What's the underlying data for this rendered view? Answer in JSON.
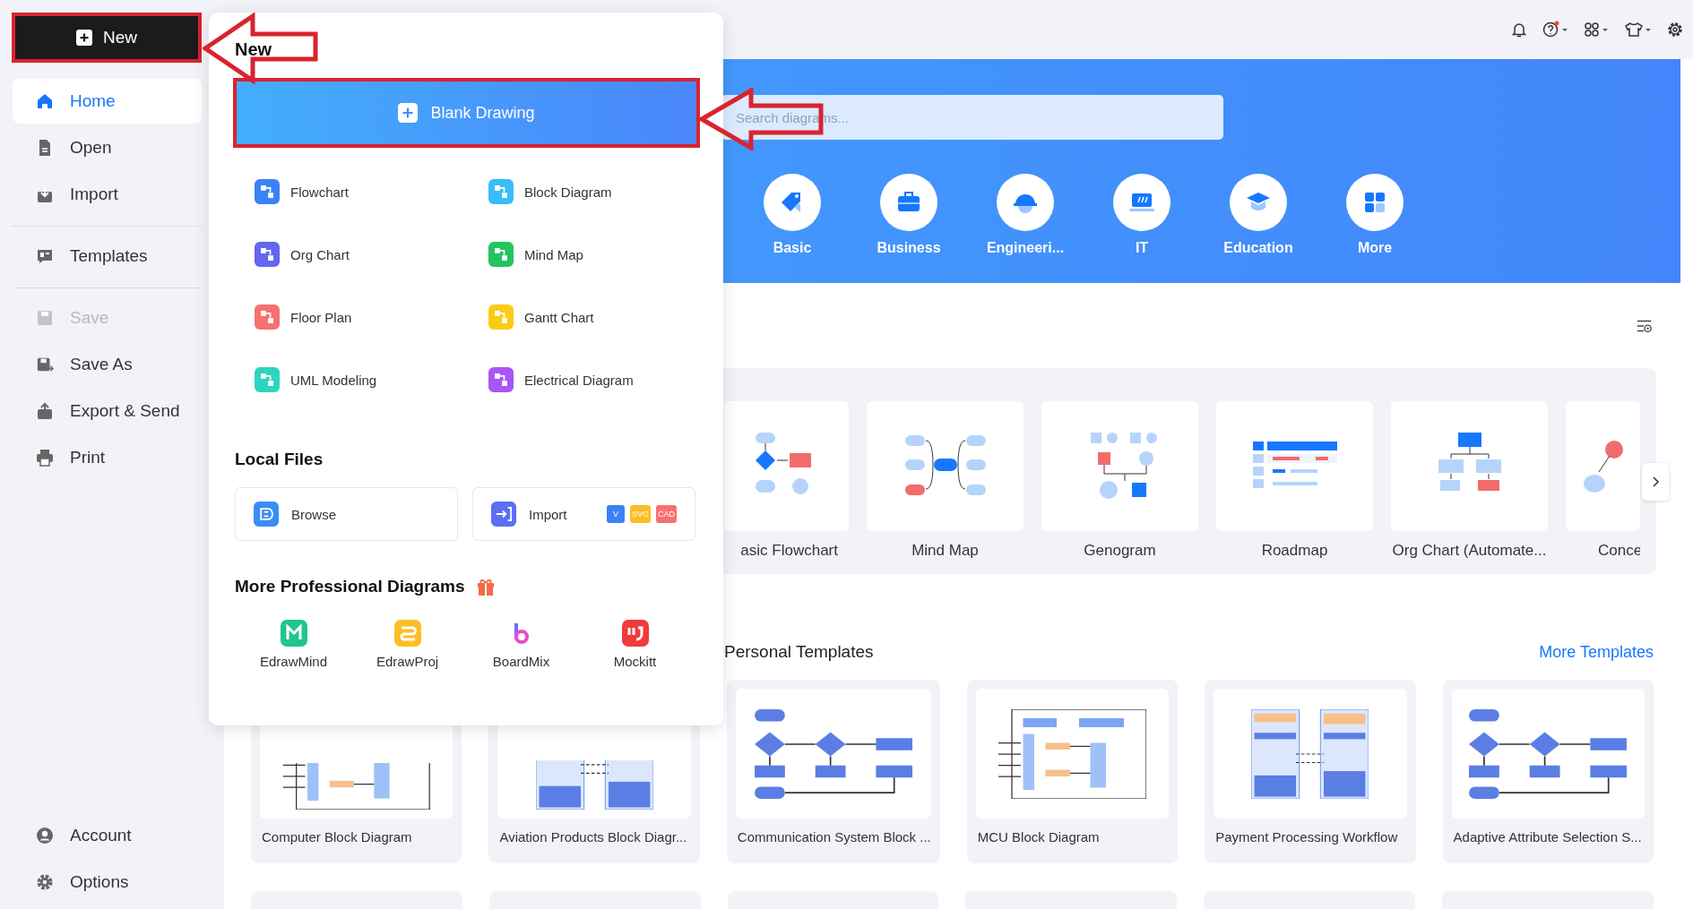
{
  "new_button": {
    "label": "New"
  },
  "sidebar": {
    "sections": [
      {
        "items": [
          {
            "label": "Home",
            "kind": "home",
            "selected": true,
            "disabled": false
          },
          {
            "label": "Open",
            "kind": "file",
            "selected": false,
            "disabled": false
          },
          {
            "label": "Import",
            "kind": "import",
            "selected": false,
            "disabled": false
          }
        ]
      },
      {
        "items": [
          {
            "label": "Templates",
            "kind": "templates",
            "selected": false,
            "disabled": false
          }
        ]
      },
      {
        "items": [
          {
            "label": "Save",
            "kind": "save",
            "selected": false,
            "disabled": true
          },
          {
            "label": "Save As",
            "kind": "saveas",
            "selected": false,
            "disabled": false
          },
          {
            "label": "Export & Send",
            "kind": "export",
            "selected": false,
            "disabled": false
          },
          {
            "label": "Print",
            "kind": "print",
            "selected": false,
            "disabled": false
          }
        ]
      }
    ],
    "bottom_items": [
      {
        "label": "Account",
        "kind": "account"
      },
      {
        "label": "Options",
        "kind": "gear"
      }
    ]
  },
  "new_menu": {
    "title": "New",
    "blank_button": "Blank Drawing",
    "diagram_types": [
      {
        "label": "Flowchart",
        "color": "#3b82f6"
      },
      {
        "label": "Block Diagram",
        "color": "#38bdf8"
      },
      {
        "label": "Org Chart",
        "color": "#6366f1"
      },
      {
        "label": "Mind Map",
        "color": "#22c55e"
      },
      {
        "label": "Floor Plan",
        "color": "#f87171"
      },
      {
        "label": "Gantt Chart",
        "color": "#facc15"
      },
      {
        "label": "UML Modeling",
        "color": "#2dd4bf"
      },
      {
        "label": "Electrical Diagram",
        "color": "#a855f7"
      }
    ],
    "local_files_title": "Local Files",
    "browse": "Browse",
    "import": "Import",
    "import_formats": [
      {
        "label": "V",
        "color": "#3b82f6"
      },
      {
        "label": "SVG",
        "color": "#fbbf24"
      },
      {
        "label": "CAD",
        "color": "#f87171"
      }
    ],
    "more_title": "More Professional Diagrams",
    "apps": [
      {
        "label": "EdrawMind",
        "kind": "mind"
      },
      {
        "label": "EdrawProj",
        "kind": "proj"
      },
      {
        "label": "BoardMix",
        "kind": "board"
      },
      {
        "label": "Mockitt",
        "kind": "mock"
      }
    ]
  },
  "banner": {
    "search_placeholder": "Search diagrams...",
    "categories": [
      {
        "label": "Basic",
        "kind": "tag"
      },
      {
        "label": "Business",
        "kind": "briefcase"
      },
      {
        "label": "Engineeri...",
        "kind": "helmet"
      },
      {
        "label": "IT",
        "kind": "laptop"
      },
      {
        "label": "Education",
        "kind": "cap"
      },
      {
        "label": "More",
        "kind": "grid"
      }
    ]
  },
  "recommended": [
    {
      "label": "asic Flowchart",
      "kind": "flowchart",
      "clipped": true
    },
    {
      "label": "Mind Map",
      "kind": "mindmap",
      "clipped": false
    },
    {
      "label": "Genogram",
      "kind": "genogram",
      "clipped": false
    },
    {
      "label": "Roadmap",
      "kind": "roadmap",
      "clipped": false
    },
    {
      "label": "Org Chart (Automate...",
      "kind": "orgchart",
      "clipped": false
    },
    {
      "label": "Conce",
      "kind": "concept",
      "clipped": false
    }
  ],
  "personal": {
    "title": "Personal Templates",
    "more_link": "More Templates",
    "templates": [
      {
        "label": "Computer Block Diagram"
      },
      {
        "label": "Aviation Products Block Diagr..."
      },
      {
        "label": "Communication System Block ..."
      },
      {
        "label": "MCU Block Diagram"
      },
      {
        "label": "Payment Processing Workflow"
      },
      {
        "label": "Adaptive Attribute Selection S..."
      }
    ]
  }
}
